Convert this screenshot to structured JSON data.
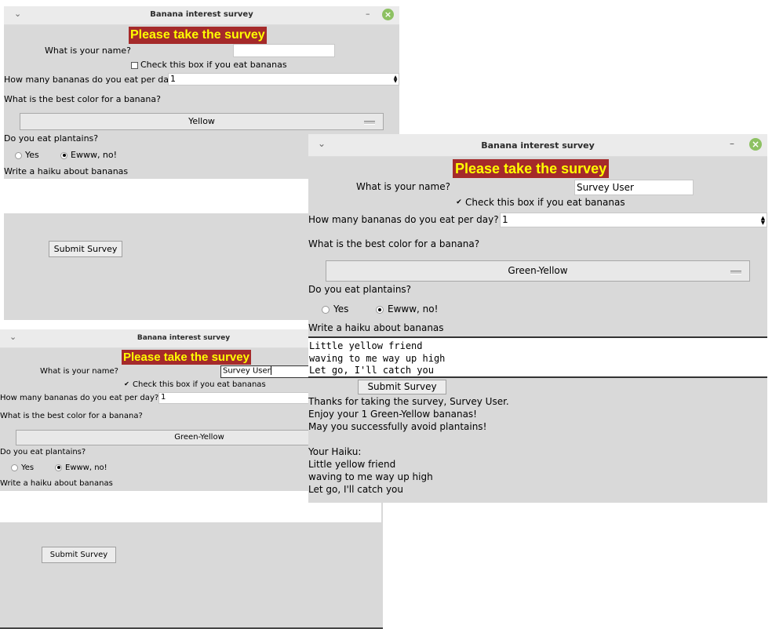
{
  "app": {
    "window_title": "Banana interest survey",
    "banner": "Please take the survey",
    "name_label": "What is your name?",
    "eat_bananas_label": "Check this box if you eat bananas",
    "bananas_per_day_label": "How many bananas do you eat per day?",
    "best_color_label": "What is the best color for a banana?",
    "plantains_label": "Do you eat plantains?",
    "plantain_yes": "Yes",
    "plantain_no": "Ewww, no!",
    "haiku_label": "Write a haiku about bananas",
    "submit_label": "Submit Survey",
    "window_controls": {
      "menu_icon": "chevron-down-icon",
      "min_glyph": "–",
      "close_glyph": "×"
    }
  },
  "windows": [
    {
      "id": "empty",
      "name_value": "",
      "eats_bananas": false,
      "bananas_per_day": "1",
      "best_color": "Yellow",
      "plantain_choice": "no",
      "haiku": "",
      "results": ""
    },
    {
      "id": "partial",
      "name_value": "Survey User",
      "eats_bananas": true,
      "bananas_per_day": "1",
      "best_color": "Green-Yellow",
      "plantain_choice": "no",
      "haiku": "",
      "results": ""
    },
    {
      "id": "submitted",
      "name_value": "Survey User",
      "eats_bananas": true,
      "bananas_per_day": "1",
      "best_color": "Green-Yellow",
      "plantain_choice": "no",
      "haiku": "Little yellow friend\nwaving to me way up high\nLet go, I'll catch you",
      "results": "Thanks for taking the survey, Survey User.\nEnjoy your 1 Green-Yellow bananas!\nMay you successfully avoid plantains!\n\nYour Haiku:\nLittle yellow friend\nwaving to me way up high\nLet go, I'll catch you"
    }
  ],
  "colors": {
    "banner_bg": "#a52a2a",
    "banner_fg": "#ffff00",
    "window_bg": "#d9d9d9",
    "close_button": "#8dc162"
  }
}
